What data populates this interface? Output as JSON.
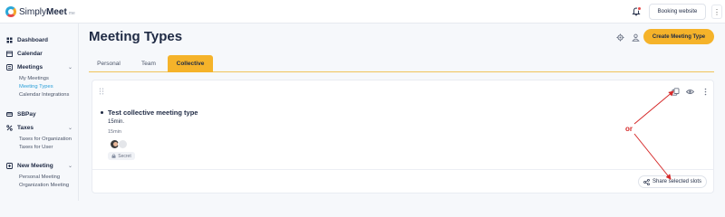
{
  "app": {
    "brand_simply": "Simply",
    "brand_meet": "Meet",
    "brand_suffix": "me"
  },
  "header": {
    "booking_label": "Booking website",
    "menu_glyph": "⋮"
  },
  "sidebar": {
    "items": [
      {
        "label": "Dashboard",
        "icon": "dashboard-icon"
      },
      {
        "label": "Calendar",
        "icon": "calendar-icon"
      },
      {
        "label": "Meetings",
        "icon": "meetings-icon",
        "caret": "⌄",
        "children": [
          "My Meetings",
          "Meeting Types",
          "Calendar Integrations"
        ],
        "active_child": "Meeting Types"
      },
      {
        "label": "SBPay",
        "icon": "pay-icon"
      },
      {
        "label": "Taxes",
        "icon": "percent-icon",
        "caret": "⌄",
        "children": [
          "Taxes for Organization",
          "Taxes for User"
        ]
      },
      {
        "label": "New Meeting",
        "icon": "plus-square-icon",
        "caret": "⌄",
        "children": [
          "Personal Meeting",
          "Organization Meeting"
        ]
      }
    ]
  },
  "main": {
    "title": "Meeting Types",
    "create_label": "Create Meeting Type",
    "tabs": [
      {
        "label": "Personal",
        "active": false
      },
      {
        "label": "Team",
        "active": false
      },
      {
        "label": "Collective",
        "active": true
      }
    ],
    "card": {
      "title": "Test collective meeting type",
      "duration_bold": "15min.",
      "duration": "15min",
      "tag": "Secret",
      "share_label": "Share selected slots"
    }
  },
  "annotation": {
    "text": "or",
    "color": "#d62a2a"
  },
  "colors": {
    "accent": "#f5b32a",
    "link": "#2a9fd8",
    "text": "#1f2a44"
  }
}
